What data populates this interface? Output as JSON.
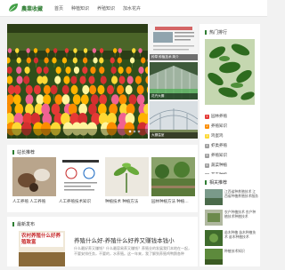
{
  "header": {
    "site_name": "農業收藏",
    "nav": [
      "首页",
      "种植知识",
      "养殖知识",
      "加水花卉"
    ]
  },
  "slider": {
    "thumbs": [
      {
        "caption": "种草 种植技术 简介"
      },
      {
        "caption": "花卉大棚"
      },
      {
        "caption": "大棚温室"
      }
    ]
  },
  "hot": {
    "title": "热门排行",
    "items": [
      {
        "num": "1",
        "label": "园林养殖",
        "color": "#e53935"
      },
      {
        "num": "2",
        "label": "养殖知识",
        "color": "#fb8c00"
      },
      {
        "num": "3",
        "label": "鸡蛋鸡",
        "color": "#fdd835"
      },
      {
        "num": "4",
        "label": "虾类养殖",
        "color": "#9e9e9e"
      },
      {
        "num": "5",
        "label": "养殖知识",
        "color": "#9e9e9e"
      },
      {
        "num": "6",
        "label": "蔬菜种植",
        "color": "#9e9e9e"
      },
      {
        "num": "7",
        "label": "花卉种植",
        "color": "#9e9e9e"
      }
    ]
  },
  "recommend": {
    "title": "站长推荐",
    "cards": [
      {
        "title": "人工养殖 人工养殖"
      },
      {
        "title": "人工养殖技术知识"
      },
      {
        "title": "种植技术 种植方法"
      },
      {
        "title": "园林种植方法 种植…"
      }
    ]
  },
  "related": {
    "title": "相关推荐",
    "items": [
      {
        "text": "江西省种养殖技术 江西省种植养殖技术服务",
        "date": "2022-06-11"
      },
      {
        "text": "农户种植技术 农户种植技术种植技术",
        "date": "2022-06-08"
      },
      {
        "text": "苗木种植 苗木种植技术 苗木种植技术",
        "date": "2022-06-06"
      },
      {
        "text": "种植技术知识",
        "date": "2022-06-02"
      }
    ]
  },
  "latest": {
    "title": "最新发布",
    "image_text": "农村养殖什么好养殖致富",
    "article_title": "养殖什么好-养殖什么好养又赚钱本钱小",
    "summary": "什么最好养又赚钱？什么最容易养又赚钱？养殖业的发展我们本地在一起，不要安排任务，不要的，水养殖。这一年来，我了解到养殖鸡鸭鹅各种"
  }
}
